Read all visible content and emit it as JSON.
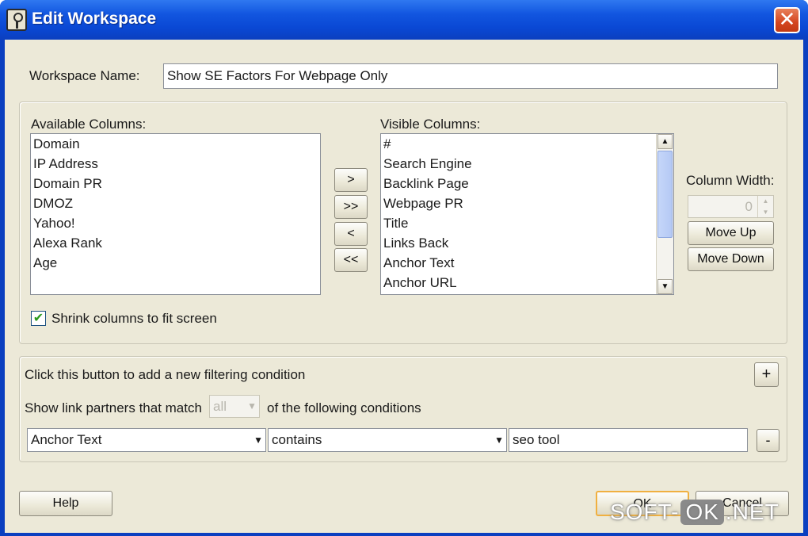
{
  "window": {
    "title": "Edit Workspace",
    "close_glyph": "✕"
  },
  "workspace_name": {
    "label": "Workspace Name:",
    "value": "Show SE Factors For Webpage Only"
  },
  "available_columns": {
    "label": "Available Columns:",
    "items": [
      "Domain",
      "IP Address",
      "Domain PR",
      "DMOZ",
      "Yahoo!",
      "Alexa Rank",
      "Age"
    ]
  },
  "visible_columns": {
    "label": "Visible Columns:",
    "items": [
      "#",
      "Search Engine",
      "Backlink Page",
      "Webpage PR",
      "Title",
      "Links Back",
      "Anchor Text",
      "Anchor URL"
    ]
  },
  "transfer_buttons": {
    "add": ">",
    "add_all": ">>",
    "remove": "<",
    "remove_all": "<<"
  },
  "column_width": {
    "label": "Column Width:",
    "value": "0",
    "move_up": "Move Up",
    "move_down": "Move Down"
  },
  "shrink": {
    "label": "Shrink columns to fit screen",
    "checked": true
  },
  "filter": {
    "add_hint": "Click this button to add a new filtering condition",
    "add_button": "+",
    "match_prefix": "Show link partners that match",
    "match_value": "all",
    "match_suffix": "of the following conditions",
    "condition": {
      "field": "Anchor Text",
      "operator": "contains",
      "value": "seo tool",
      "remove_button": "-"
    }
  },
  "footer": {
    "help": "Help",
    "ok": "OK",
    "cancel": "Cancel"
  },
  "watermark": {
    "left": "SOFT-",
    "middle": "OK",
    "right": ".NET"
  },
  "colors": {
    "titlebar": "#0a48d4",
    "dialog_bg": "#ece9d8",
    "close_button": "#d4451f",
    "thumb": "#b5c9f4"
  }
}
